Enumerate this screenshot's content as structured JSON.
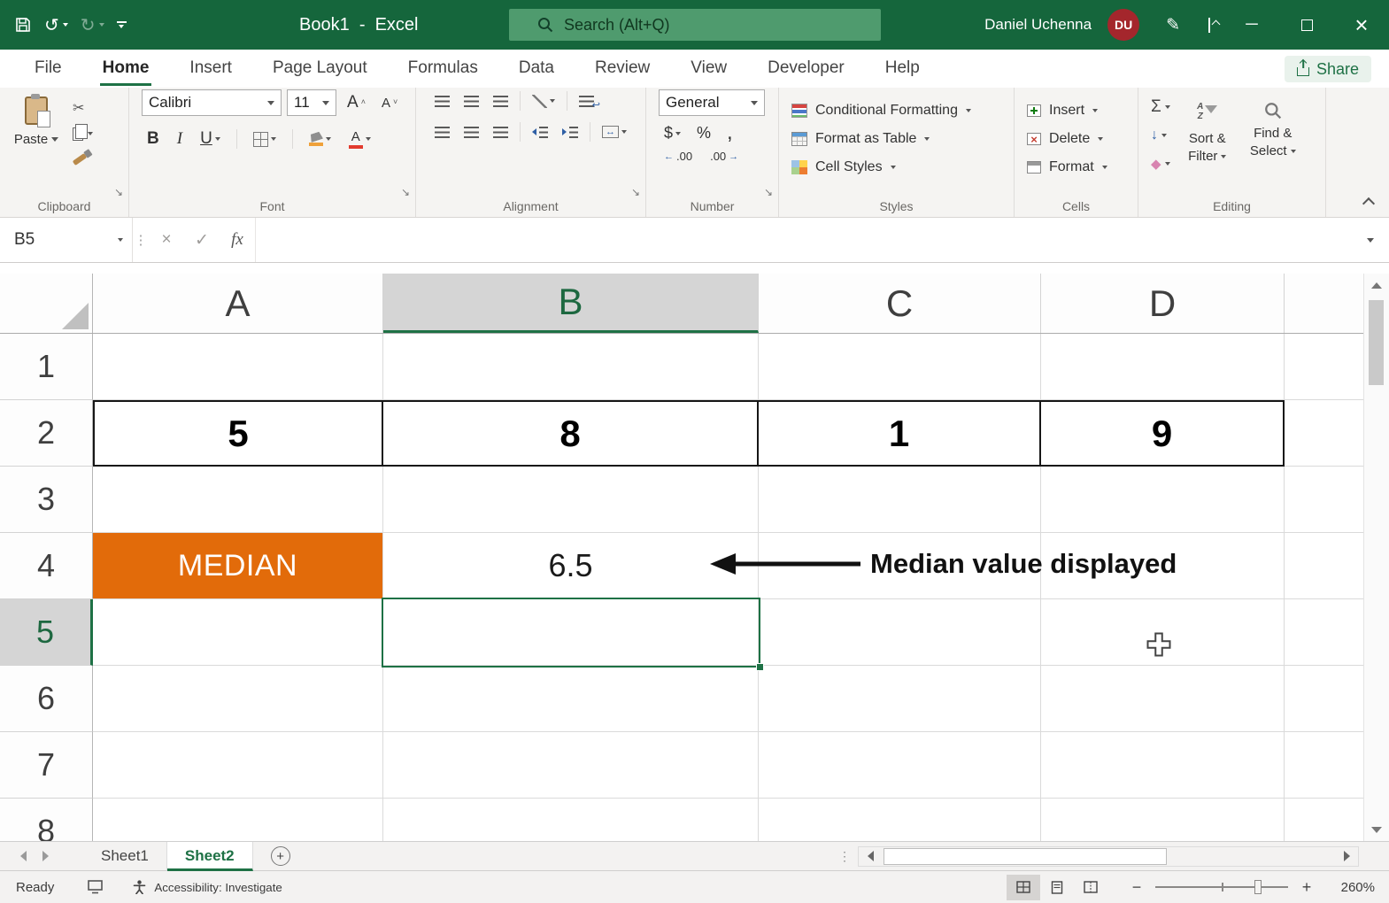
{
  "colors": {
    "title_green": "#15663C",
    "search_green": "#4F9B6E",
    "accent_green": "#1E7145",
    "median_orange": "#E26B0A",
    "avatar_red": "#A4262C"
  },
  "title_bar": {
    "app_title": "Book1  -  Excel",
    "search_placeholder": "Search (Alt+Q)",
    "user_name": "Daniel Uchenna",
    "user_initials": "DU"
  },
  "menu": {
    "tabs": [
      "File",
      "Home",
      "Insert",
      "Page Layout",
      "Formulas",
      "Data",
      "Review",
      "View",
      "Developer",
      "Help"
    ],
    "active_tab": "Home",
    "share_label": "Share"
  },
  "icons": {
    "undo": "↺",
    "redo": "↻",
    "pen": "✎",
    "minimize": "─",
    "close_window": "×",
    "scissors": "✂",
    "bold": "B",
    "italic": "I",
    "underline": "U",
    "grow_a": "A",
    "shrink_a": "A",
    "font_color_a": "A",
    "currency": "$",
    "percent": "%",
    "comma": ",",
    "decimals": ".00",
    "arrow_left": "←",
    "arrow_right": "→",
    "return_arrow": "↩",
    "merge_arrows": "↔",
    "autosum": "Σ",
    "fill_down": "↓",
    "clear_diamond": "◆",
    "sort_a": "A",
    "sort_z": "Z",
    "delete_x": "×",
    "cancel_x": "×",
    "check": "✓",
    "vdots": "⋮",
    "dialog_launcher": "↘",
    "fx": "fx",
    "minus": "−",
    "plus": "+"
  },
  "ribbon": {
    "paste_label": "Paste",
    "font_name": "Calibri",
    "font_size": "11",
    "number_format": "General",
    "conditional_formatting": "Conditional Formatting",
    "format_as_table": "Format as Table",
    "cell_styles": "Cell Styles",
    "insert_label": "Insert",
    "delete_label": "Delete",
    "format_label": "Format",
    "sort_filter_line1": "Sort &",
    "sort_filter_line2": "Filter",
    "find_select_line1": "Find &",
    "find_select_line2": "Select",
    "group_labels": [
      "Clipboard",
      "Font",
      "Alignment",
      "Number",
      "Styles",
      "Cells",
      "Editing"
    ]
  },
  "formula_bar": {
    "name_box": "B5",
    "formula_value": ""
  },
  "grid": {
    "col_headers": [
      "A",
      "B",
      "C",
      "D"
    ],
    "row_headers": [
      "1",
      "2",
      "3",
      "4",
      "5",
      "6",
      "7",
      "8"
    ],
    "active_cell": "B5",
    "cells": {
      "A2": "5",
      "B2": "8",
      "C2": "1",
      "D2": "9",
      "A4": "MEDIAN",
      "B4": "6.5"
    },
    "annotation_text": "Median value displayed"
  },
  "sheet_bar": {
    "tabs": [
      "Sheet1",
      "Sheet2"
    ],
    "active_tab": "Sheet2",
    "add_sheet": "+"
  },
  "status_bar": {
    "mode": "Ready",
    "accessibility": "Accessibility: Investigate",
    "zoom_level": "260%"
  }
}
